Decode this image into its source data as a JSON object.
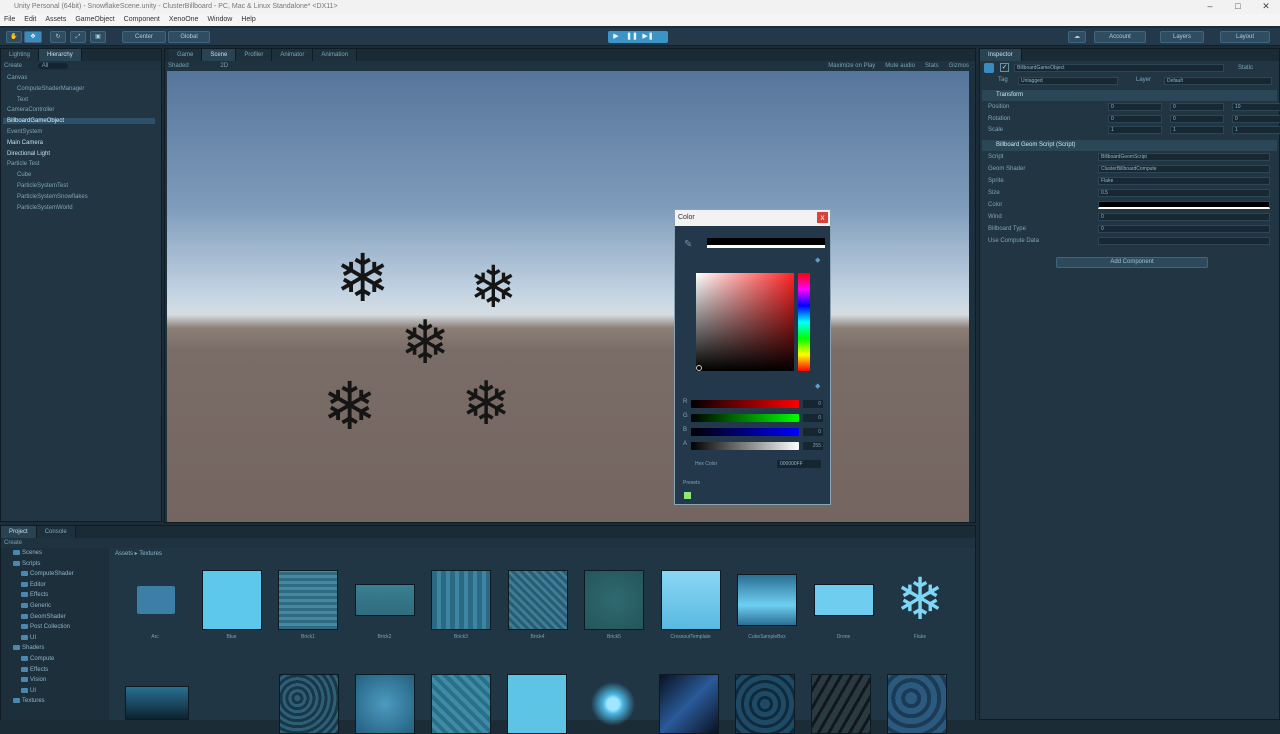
{
  "window": {
    "title": "Unity Personal (64bit) - SnowflakeScene.unity - ClusterBillboard - PC, Mac & Linux Standalone* <DX11>",
    "controls": [
      "–",
      "□",
      "✕"
    ]
  },
  "menu": [
    "File",
    "Edit",
    "Assets",
    "GameObject",
    "Component",
    "XenoOne",
    "Window",
    "Help"
  ],
  "toolbar": {
    "pivot": "Center",
    "space": "Global",
    "account": "Account",
    "layers": "Layers",
    "layout": "Layout"
  },
  "hierarchy": {
    "tabs": [
      "Lighting",
      "Hierarchy"
    ],
    "create": "Create",
    "search": "All",
    "items": [
      {
        "label": "Canvas",
        "indent": 0,
        "style": "dim"
      },
      {
        "label": "ComputeShaderManager",
        "indent": 1,
        "style": "dim"
      },
      {
        "label": "Text",
        "indent": 1,
        "style": "dim"
      },
      {
        "label": "CameraController",
        "indent": 0,
        "style": "dim"
      },
      {
        "label": "BillboardGameObject",
        "indent": 0,
        "style": "sel"
      },
      {
        "label": "EventSystem",
        "indent": 0,
        "style": "dim"
      },
      {
        "label": "Main Camera",
        "indent": 0,
        "style": "bright"
      },
      {
        "label": "Directional Light",
        "indent": 0,
        "style": "bright"
      },
      {
        "label": "Particle Test",
        "indent": 0,
        "style": "dim"
      },
      {
        "label": "Cube",
        "indent": 1,
        "style": "dim"
      },
      {
        "label": "ParticleSystemTest",
        "indent": 1,
        "style": "dim"
      },
      {
        "label": "ParticleSystemSnowflakes",
        "indent": 1,
        "style": "dim"
      },
      {
        "label": "ParticleSystemWorld",
        "indent": 1,
        "style": "dim"
      }
    ]
  },
  "scene": {
    "tabs": [
      "Game",
      "Scene",
      "Profiler",
      "Animator",
      "Animation"
    ],
    "active_tab": 1,
    "shading": "Shaded",
    "mode": "2D",
    "right_tools": [
      "Maximize on Play",
      "Mute audio",
      "Stats",
      "Gizmos"
    ]
  },
  "color_picker": {
    "title": "Color",
    "close": "x",
    "sliders": [
      {
        "label": "R",
        "value": "0"
      },
      {
        "label": "G",
        "value": "0"
      },
      {
        "label": "B",
        "value": "0"
      },
      {
        "label": "A",
        "value": "255"
      }
    ],
    "hex_label": "Hex Color",
    "hex_value": "000000FF",
    "presets_label": "Presets"
  },
  "inspector": {
    "tab": "Inspector",
    "object_name": "BillboardGameObject",
    "static_label": "Static",
    "tag_label": "Tag",
    "tag_value": "Untagged",
    "layer_label": "Layer",
    "layer_value": "Default",
    "transform_title": "Transform",
    "transform_rows": [
      {
        "label": "Position",
        "x": "0",
        "y": "0",
        "z": "10"
      },
      {
        "label": "Rotation",
        "x": "0",
        "y": "0",
        "z": "0"
      },
      {
        "label": "Scale",
        "x": "1",
        "y": "1",
        "z": "1"
      }
    ],
    "script_title": "Billboard Geom Script (Script)",
    "script_rows": [
      {
        "label": "Script",
        "value": "BillboardGeomScript"
      },
      {
        "label": "Geom Shader",
        "value": "ClusterBillboardCompute"
      },
      {
        "label": "Sprite",
        "value": "Flake"
      },
      {
        "label": "Size",
        "value": "0.5"
      },
      {
        "label": "Color",
        "value": ""
      },
      {
        "label": "Wind",
        "value": "0"
      },
      {
        "label": "Billboard Type",
        "value": "0"
      },
      {
        "label": "Use Compute Data",
        "value": ""
      }
    ],
    "add_component": "Add Component"
  },
  "project": {
    "tabs": [
      "Project",
      "Console"
    ],
    "create": "Create",
    "breadcrumb": "Assets ▸ Textures",
    "folders": [
      {
        "label": "Scenes",
        "indent": 1
      },
      {
        "label": "Scripts",
        "indent": 1
      },
      {
        "label": "ComputeShader",
        "indent": 2
      },
      {
        "label": "Editor",
        "indent": 2
      },
      {
        "label": "Effects",
        "indent": 2
      },
      {
        "label": "Generic",
        "indent": 2
      },
      {
        "label": "GeomShader",
        "indent": 2
      },
      {
        "label": "Post Collection",
        "indent": 2
      },
      {
        "label": "UI",
        "indent": 2
      },
      {
        "label": "Shaders",
        "indent": 1
      },
      {
        "label": "Compute",
        "indent": 2
      },
      {
        "label": "Effects",
        "indent": 2
      },
      {
        "label": "Vision",
        "indent": 2
      },
      {
        "label": "UI",
        "indent": 2
      },
      {
        "label": "Textures",
        "indent": 1
      }
    ],
    "assets_row1": [
      {
        "label": "Arc",
        "kind": "folder"
      },
      {
        "label": "Blue",
        "kind": "solid"
      },
      {
        "label": "Brick1",
        "kind": "tex1"
      },
      {
        "label": "Brick2",
        "kind": "tex2"
      },
      {
        "label": "Brick3",
        "kind": "tex3"
      },
      {
        "label": "Brick4",
        "kind": "tex4"
      },
      {
        "label": "Brick5",
        "kind": "tex5"
      },
      {
        "label": "CrossoutTemplate",
        "kind": "sketch"
      },
      {
        "label": "CubeSampleBox",
        "kind": "grad"
      },
      {
        "label": "Drone",
        "kind": "drone"
      },
      {
        "label": "Flake",
        "kind": "flake"
      }
    ]
  },
  "colors": {
    "accent": "#3a8cc0",
    "panel": "#213543",
    "selection": "#2e5169"
  }
}
